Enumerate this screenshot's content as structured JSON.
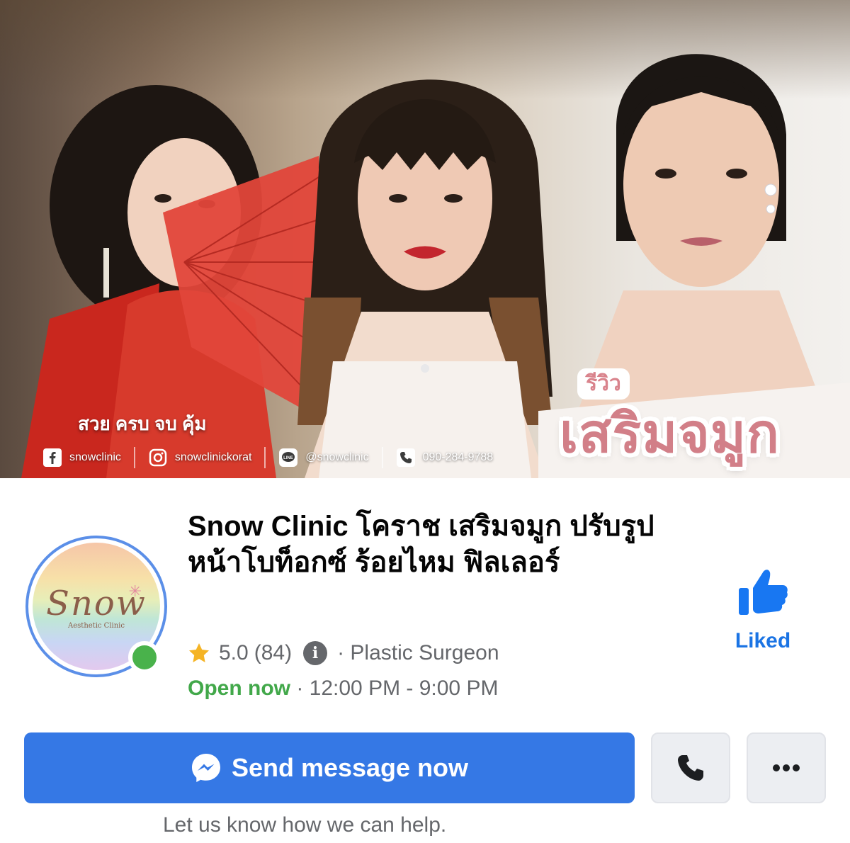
{
  "cover": {
    "slogan": "สวย ครบ จบ คุ้ม",
    "contacts": [
      {
        "icon": "facebook-icon",
        "label": "snowclinic"
      },
      {
        "icon": "instagram-icon",
        "label": "snowclinickorat"
      },
      {
        "icon": "line-icon",
        "label": "@snowclinic"
      },
      {
        "icon": "phone-icon",
        "label": "090-284-9788"
      }
    ],
    "badge": "รีวิว",
    "headline": "เสริมจมูก"
  },
  "avatar": {
    "logo_text": "Snow",
    "logo_sub": "Aesthetic Clinic",
    "online": true
  },
  "page": {
    "name": "Snow Clinic โคราช เสริมจมูก ปรับรูปหน้าโบท็อกซ์ ร้อยไหม ฟิลเลอร์",
    "rating": "5.0",
    "review_count": "(84)",
    "category": "· Plastic Surgeon",
    "open_status": "Open now",
    "hours": " · 12:00 PM - 9:00 PM"
  },
  "like": {
    "label": "Liked",
    "color": "#1b74e4"
  },
  "actions": {
    "send_label": "Send message now",
    "call_icon": "phone-icon",
    "more_icon": "more-icon",
    "help_text": "Let us know how we can help."
  },
  "colors": {
    "primary": "#3578e5",
    "online": "#49b24b",
    "open": "#42a84a",
    "secondary_text": "#65676b"
  }
}
